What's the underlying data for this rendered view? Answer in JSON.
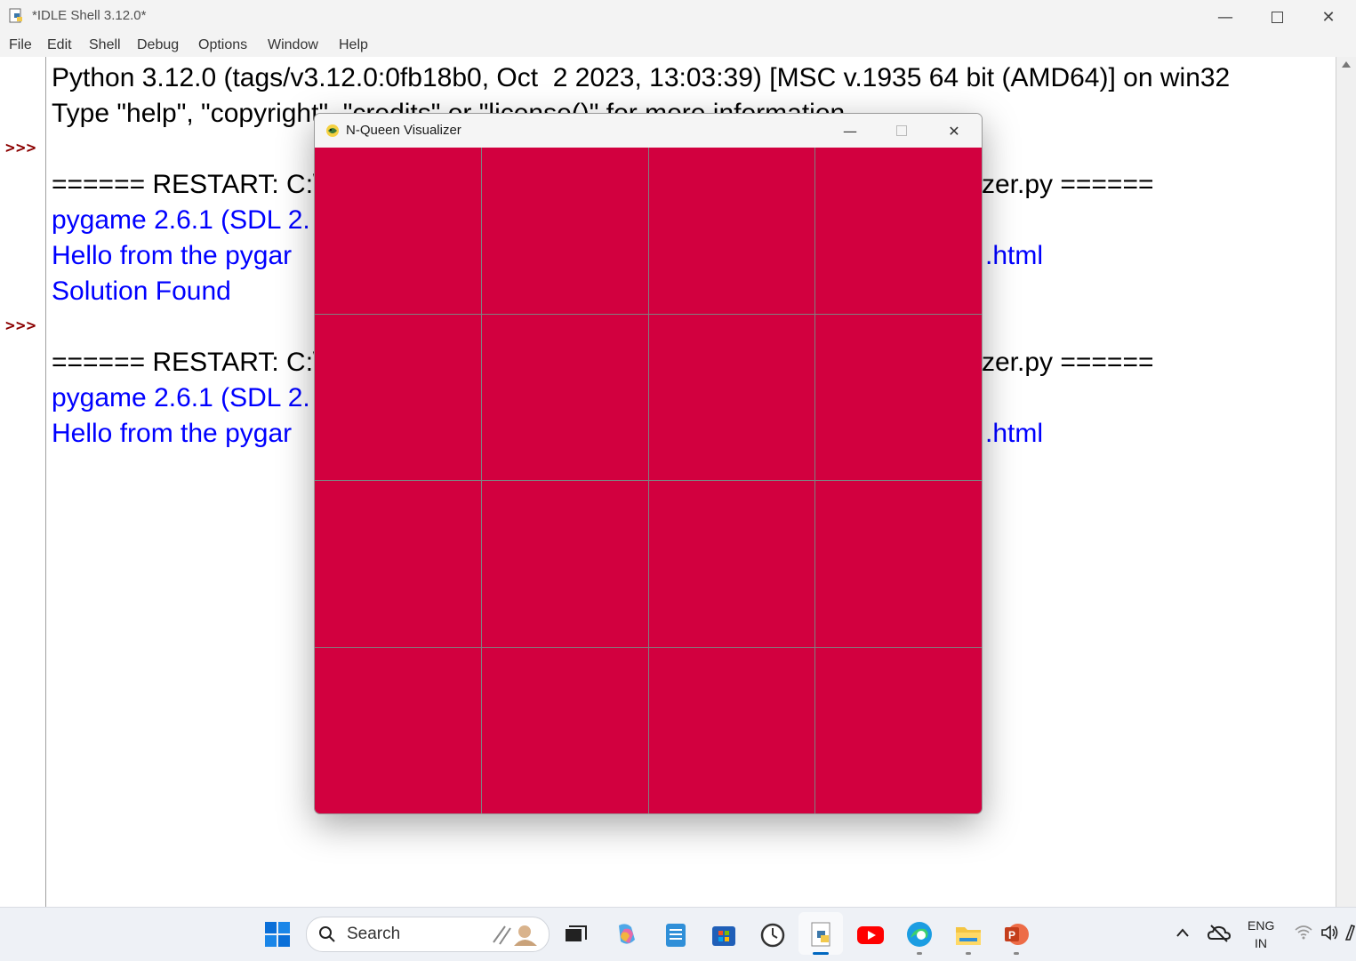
{
  "idle": {
    "title": "*IDLE Shell 3.12.0*",
    "menu": [
      "File",
      "Edit",
      "Shell",
      "Debug",
      "Options",
      "Window",
      "Help"
    ],
    "prompt": ">>>",
    "lines": [
      "Python 3.12.0 (tags/v3.12.0:0fb18b0, Oct  2 2023, 13:03:39) [MSC v.1935 64 bit (AMD64)] on win32",
      "Type \"help\", \"copyright\", \"credits\" or \"license()\" for more information.",
      "====== RESTART: C:\\",
      "zer.py ======",
      "pygame 2.6.1 (SDL 2.",
      "Hello from the pygar",
      ".html",
      "Solution Found",
      "====== RESTART: C:\\",
      "zer.py ======",
      "pygame 2.6.1 (SDL 2.",
      "Hello from the pygar",
      ".html"
    ]
  },
  "visualizer": {
    "title": "N-Queen Visualizer",
    "board_size": 4,
    "cell_color": "#d2003f",
    "grid_color": "#808080"
  },
  "taskbar": {
    "search_placeholder": "Search",
    "lang_top": "ENG",
    "lang_bottom": "IN"
  }
}
